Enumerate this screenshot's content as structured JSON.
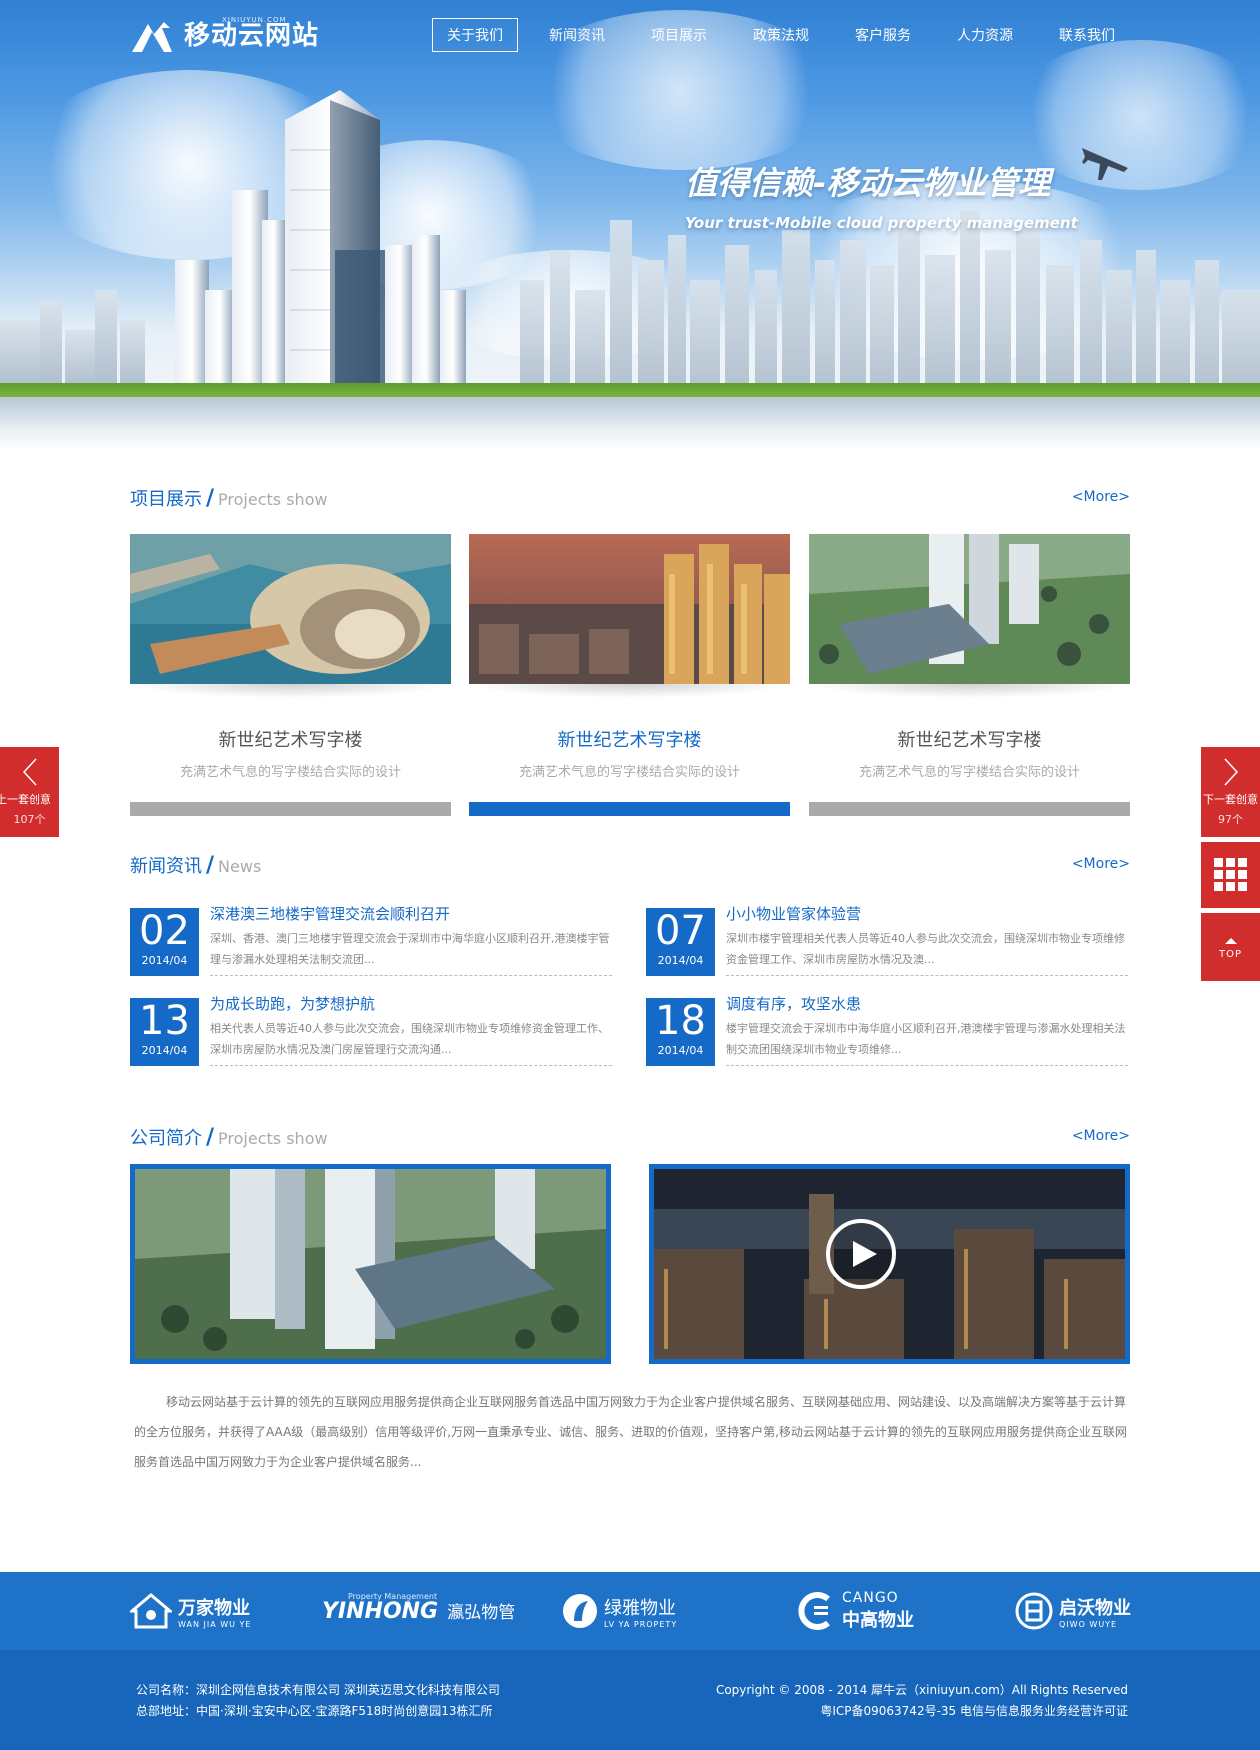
{
  "brand": {
    "name": "移动云网站",
    "subdomain": "XINIUYUN.COM"
  },
  "nav": [
    {
      "label": "关于我们",
      "active": true
    },
    {
      "label": "新闻资讯"
    },
    {
      "label": "项目展示"
    },
    {
      "label": "政策法规"
    },
    {
      "label": "客户服务"
    },
    {
      "label": "人力资源"
    },
    {
      "label": "联系我们"
    }
  ],
  "hero": {
    "slogan_cn": "值得信赖-移动云物业管理",
    "slogan_en": "Your trust-Mobile cloud property management"
  },
  "projects": {
    "title": "项目展示",
    "subtitle": "Projects show",
    "more": "<More>",
    "items": [
      {
        "name": "新世纪艺术写字楼",
        "desc": "充满艺术气息的写字楼结合实际的设计",
        "active": false
      },
      {
        "name": "新世纪艺术写字楼",
        "desc": "充满艺术气息的写字楼结合实际的设计",
        "active": true
      },
      {
        "name": "新世纪艺术写字楼",
        "desc": "充满艺术气息的写字楼结合实际的设计",
        "active": false
      }
    ]
  },
  "news": {
    "title": "新闻资讯",
    "subtitle": "News",
    "more": "<More>",
    "items": [
      {
        "day": "02",
        "ym": "2014/04",
        "title": "深港澳三地楼宇管理交流会顺利召开",
        "desc": "深圳、香港、澳门三地楼宇管理交流会于深圳市中海华庭小区顺利召开,港澳楼宇管理与渗漏水处理相关法制交流团..."
      },
      {
        "day": "07",
        "ym": "2014/04",
        "title": "小小物业管家体验营",
        "desc": "深圳市楼宇管理相关代表人员等近40人参与此次交流会，围绕深圳市物业专项维修资金管理工作、深圳市房屋防水情况及澳..."
      },
      {
        "day": "13",
        "ym": "2014/04",
        "title": "为成长助跑，为梦想护航",
        "desc": "相关代表人员等近40人参与此次交流会，围绕深圳市物业专项维修资金管理工作、深圳市房屋防水情况及澳门房屋管理行交流沟通..."
      },
      {
        "day": "18",
        "ym": "2014/04",
        "title": "调度有序，攻坚水患",
        "desc": "楼宇管理交流会于深圳市中海华庭小区顺利召开,港澳楼宇管理与渗漏水处理相关法制交流团围绕深圳市物业专项维修..."
      }
    ]
  },
  "company": {
    "title": "公司简介",
    "subtitle": "Projects show",
    "more": "<More>",
    "intro": "移动云网站基于云计算的领先的互联网应用服务提供商企业互联网服务首选品中国万网致力于为企业客户提供域名服务、互联网基础应用、网站建设、以及高端解决方案等基于云计算的全方位服务，并获得了AAA级（最高级别）信用等级评价,万网一直秉承专业、诚信、服务、进取的价值观，坚持客户第,移动云网站基于云计算的领先的互联网应用服务提供商企业互联网服务首选品中国万网致力于为企业客户提供域名服务..."
  },
  "partners": [
    {
      "cn": "万家物业",
      "en": "WAN JIA WU YE"
    },
    {
      "cn": "瀛弘物管",
      "en": "YINHONG",
      "tag": "Property Management"
    },
    {
      "cn": "绿雅物业",
      "en": "LV YA PROPETY"
    },
    {
      "cn": "中高物业",
      "en": "CANGO"
    },
    {
      "cn": "启沃物业",
      "en": "QIWO WUYE"
    }
  ],
  "footer": {
    "company": "公司名称：深圳企网信息技术有限公司  深圳英迈思文化科技有限公司",
    "address": "总部地址：中国·深圳·宝安中心区·宝源路F518时尚创意园13栋汇所",
    "copyright": "Copyright © 2008 - 2014 犀牛云（xiniuyun.com）All Rights Reserved",
    "icp": "粤ICP备09063742号-35   电信与信息服务业务经营许可证"
  },
  "side": {
    "prev": {
      "label": "上一套创意",
      "count": "107个"
    },
    "next": {
      "label": "下一套创意",
      "count": "97个"
    },
    "top": "TOP"
  },
  "colors": {
    "primary": "#1569c7",
    "side": "#d22d2d"
  }
}
